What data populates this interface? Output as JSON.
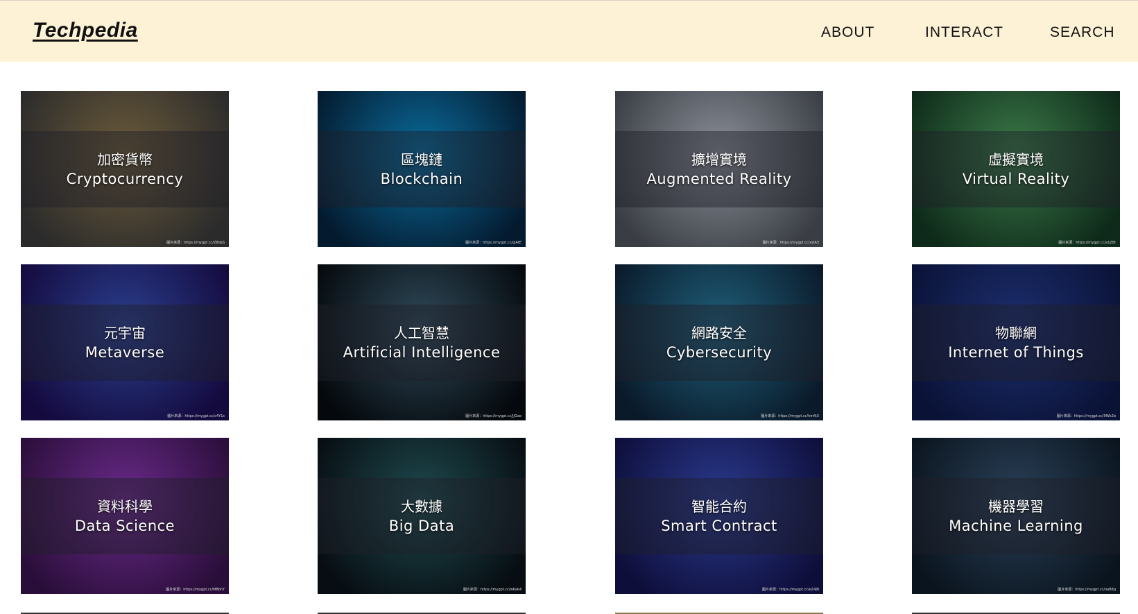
{
  "header": {
    "logo": "Techpedia",
    "nav": [
      "ABOUT",
      "INTERACT",
      "SEARCH"
    ],
    "background_color": "#fdf2d6"
  },
  "cards": [
    {
      "zh": "加密貨幣",
      "en": "Cryptocurrency",
      "credit": "圖片來源：https://mygpt.cc/Z8daS",
      "colors": [
        "#6b5a3a",
        "#2b2b2b"
      ]
    },
    {
      "zh": "區塊鏈",
      "en": "Blockchain",
      "credit": "圖片來源：https://mygpt.cc/glAtE",
      "colors": [
        "#0a6b9c",
        "#041a2e"
      ]
    },
    {
      "zh": "擴增實境",
      "en": "Augmented Reality",
      "credit": "圖片來源：https://mygpt.cc/xzlA3",
      "colors": [
        "#8a8f98",
        "#3a3e44"
      ]
    },
    {
      "zh": "虛擬實境",
      "en": "Virtual Reality",
      "credit": "圖片來源：https://mygpt.cc/a1Z8t",
      "colors": [
        "#3b7a48",
        "#0e2a1a"
      ]
    },
    {
      "zh": "元宇宙",
      "en": "Metaverse",
      "credit": "圖片來源：https://mygpt.cc/c4Y1s",
      "colors": [
        "#2a3f8e",
        "#140a3e"
      ]
    },
    {
      "zh": "人工智慧",
      "en": "Artificial Intelligence",
      "credit": "圖片來源：https://mygpt.cc/JJGae",
      "colors": [
        "#2f4a5a",
        "#05090d"
      ]
    },
    {
      "zh": "網路安全",
      "en": "Cybersecurity",
      "credit": "圖片來源：https://mygpt.cc/hmfk3",
      "colors": [
        "#1f5f7a",
        "#0a1a2a"
      ]
    },
    {
      "zh": "物聯網",
      "en": "Internet of Things",
      "credit": "圖片來源：https://mygpt.cc/9Wk2b",
      "colors": [
        "#1c2e6e",
        "#0a1236"
      ]
    },
    {
      "zh": "資料科學",
      "en": "Data Science",
      "credit": "圖片來源：https://mygpt.cc/M8bhY",
      "colors": [
        "#6a2a8a",
        "#2a0e3a"
      ]
    },
    {
      "zh": "大數據",
      "en": "Big Data",
      "credit": "圖片來源：https://mygpt.cc/w6ak4",
      "colors": [
        "#1e4a4e",
        "#070d12"
      ]
    },
    {
      "zh": "智能合約",
      "en": "Smart Contract",
      "credit": "圖片來源：https://mygpt.cc/eZ4J8",
      "colors": [
        "#2a3a8e",
        "#0e0e3a"
      ]
    },
    {
      "zh": "機器學習",
      "en": "Machine Learning",
      "credit": "圖片來源：https://mygpt.cc/oaB8g",
      "colors": [
        "#2a4058",
        "#0a141e"
      ]
    }
  ]
}
